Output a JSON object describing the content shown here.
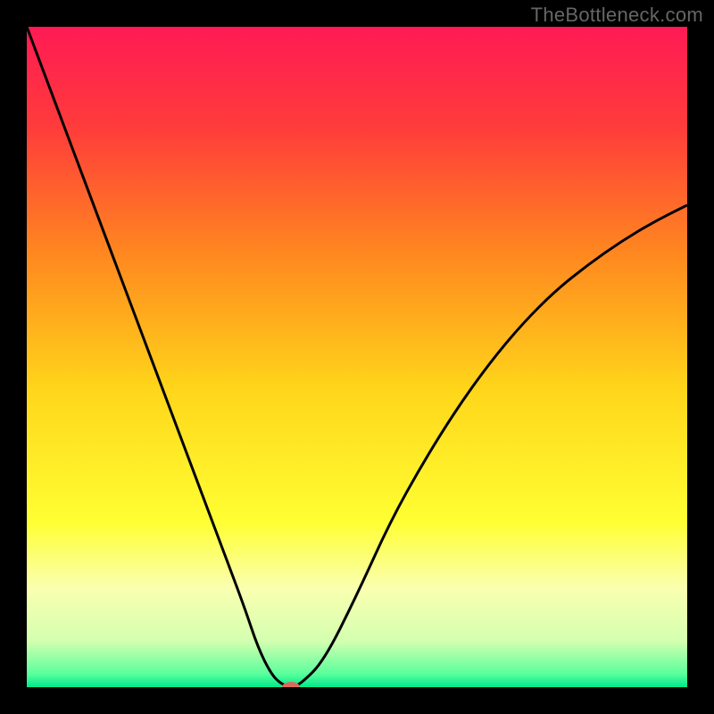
{
  "watermark": "TheBottleneck.com",
  "chart_data": {
    "type": "line",
    "title": "",
    "xlabel": "",
    "ylabel": "",
    "xlim": [
      0,
      100
    ],
    "ylim": [
      0,
      100
    ],
    "background_gradient": {
      "direction": "vertical",
      "stops": [
        {
          "offset": 0.0,
          "color": "#ff1a55"
        },
        {
          "offset": 0.15,
          "color": "#ff3b3b"
        },
        {
          "offset": 0.35,
          "color": "#ff8a1f"
        },
        {
          "offset": 0.55,
          "color": "#ffd61a"
        },
        {
          "offset": 0.75,
          "color": "#ffff33"
        },
        {
          "offset": 0.85,
          "color": "#faffb0"
        },
        {
          "offset": 0.93,
          "color": "#d4ffb0"
        },
        {
          "offset": 0.98,
          "color": "#59ff9c"
        },
        {
          "offset": 1.0,
          "color": "#00e88a"
        }
      ]
    },
    "series": [
      {
        "name": "bottleneck-curve",
        "color": "#000000",
        "x": [
          0,
          3,
          6,
          9,
          12,
          15,
          18,
          21,
          24,
          27,
          30,
          33,
          35,
          37,
          38.5,
          40,
          41.5,
          45,
          50,
          55,
          60,
          65,
          70,
          75,
          80,
          85,
          90,
          95,
          100
        ],
        "y": [
          100,
          92,
          84,
          76,
          68,
          60,
          52,
          44,
          36,
          28,
          20,
          12,
          6,
          2,
          0.5,
          0,
          0.5,
          4,
          14,
          25,
          34,
          42,
          49,
          55,
          60,
          64,
          67.5,
          70.5,
          73
        ]
      }
    ],
    "marker": {
      "name": "optimal-point",
      "x": 40,
      "y": 0,
      "color": "#d9695c",
      "rx": 10,
      "ry": 6
    }
  }
}
